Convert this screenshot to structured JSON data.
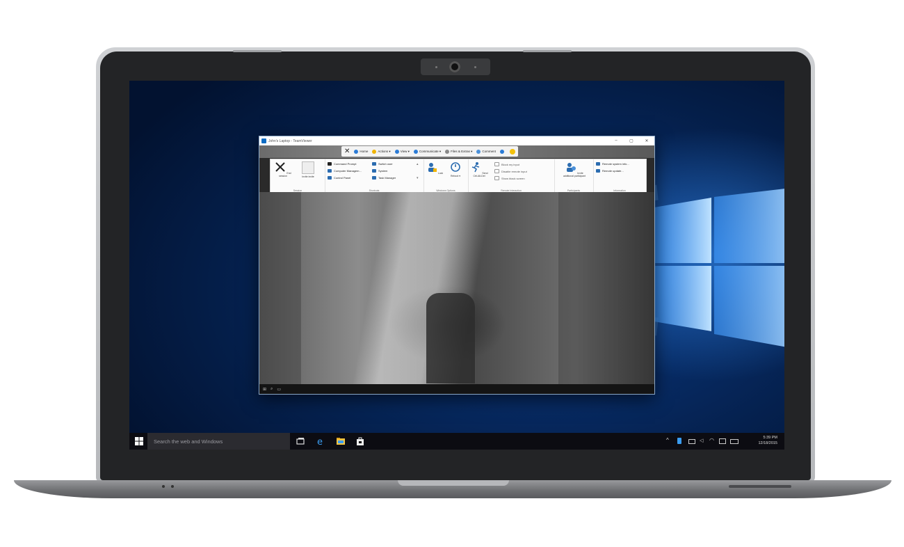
{
  "remote_window": {
    "title": "John's Laptop - TeamViewer",
    "tabs": [
      {
        "label": "Home"
      },
      {
        "label": "Actions ▾"
      },
      {
        "label": "View ▾"
      },
      {
        "label": "Communicate ▾"
      },
      {
        "label": "Files & Extras ▾"
      },
      {
        "label": "Comment"
      }
    ],
    "ribbon": {
      "session_group": {
        "caption": "Session",
        "end_session_label": "End session",
        "invite_label": "Invite invite"
      },
      "shortcuts_group": {
        "caption": "Shortcuts",
        "items": [
          "Command Prompt",
          "Computer Managem...",
          "Control Panel",
          "Switch user",
          "System",
          "Task Manager"
        ]
      },
      "windows_options_group": {
        "caption": "Windows Options",
        "lock_label": "Lock",
        "reboot_label": "Reboot ▾"
      },
      "remote_interaction_group": {
        "caption": "Remote Interaction",
        "send_label": "Send Ctrl-Alt-Del",
        "options": [
          "Block my input",
          "Disable remote input",
          "Show black screen"
        ]
      },
      "participants_group": {
        "caption": "Participants",
        "invite_label": "Invite additional participant"
      },
      "information_group": {
        "caption": "Information",
        "items": [
          "Remote system info...",
          "Remote update..."
        ]
      }
    }
  },
  "taskbar": {
    "search_placeholder": "Search the web and Windows",
    "time": "5:39 PM",
    "date": "12/18/2015"
  },
  "colors": {
    "desktop_blue": "#0a3b86",
    "accent": "#0e6cc4",
    "taskbar": "#0c0c12"
  }
}
